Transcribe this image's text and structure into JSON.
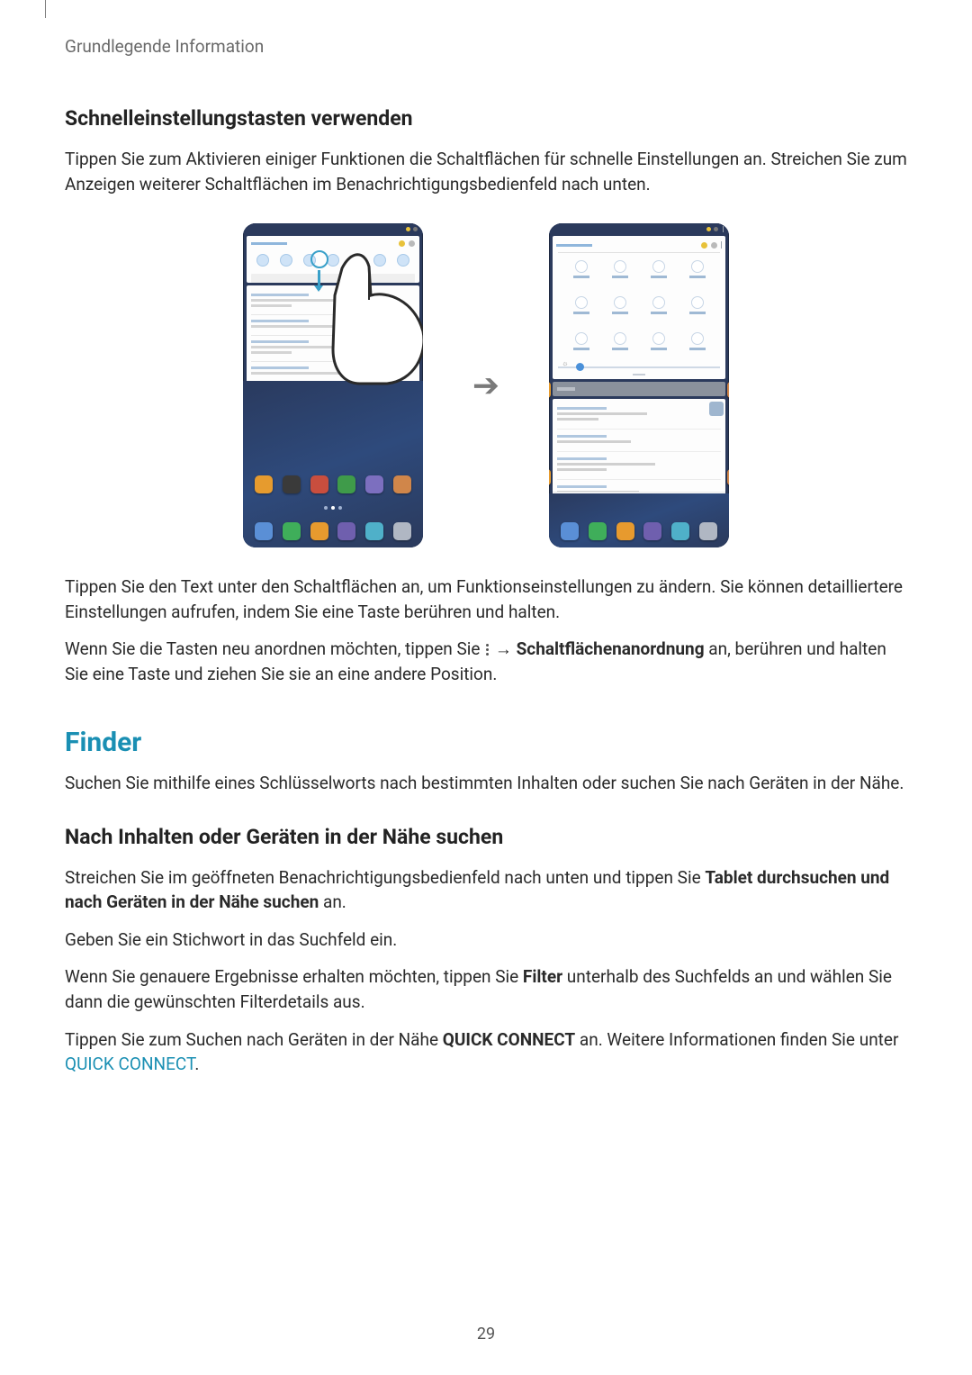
{
  "header": {
    "running": "Grundlegende Information"
  },
  "section1": {
    "heading": "Schnelleinstellungstasten verwenden",
    "p1": "Tippen Sie zum Aktivieren einiger Funktionen die Schaltflächen für schnelle Einstellungen an. Streichen Sie zum Anzeigen weiterer Schaltflächen im Benachrichtigungsbedienfeld nach unten.",
    "p2a": "Tippen Sie den Text unter den Schaltflächen an, um Funktionseinstellungen zu ändern. Sie können detailliertere Einstellungen aufrufen, indem Sie eine Taste berühren und halten.",
    "p3_pre": "Wenn Sie die Tasten neu anordnen möchten, tippen Sie ",
    "p3_arrow": " → ",
    "p3_bold": "Schaltflächenanordnung",
    "p3_post": " an, berühren und halten Sie eine Taste und ziehen Sie sie an eine andere Position."
  },
  "finder": {
    "heading": "Finder",
    "intro": "Suchen Sie mithilfe eines Schlüsselworts nach bestimmten Inhalten oder suchen Sie nach Geräten in der Nähe."
  },
  "section2": {
    "heading": "Nach Inhalten oder Geräten in der Nähe suchen",
    "p1_pre": "Streichen Sie im geöffneten Benachrichtigungsbedienfeld nach unten und tippen Sie ",
    "p1_bold": "Tablet durchsuchen und nach Geräten in der Nähe suchen",
    "p1_post": " an.",
    "p2": "Geben Sie ein Stichwort in das Suchfeld ein.",
    "p3_pre": "Wenn Sie genauere Ergebnisse erhalten möchten, tippen Sie ",
    "p3_bold": "Filter",
    "p3_post": " unterhalb des Suchfelds an und wählen Sie dann die gewünschten Filterdetails aus.",
    "p4_pre": "Tippen Sie zum Suchen nach Geräten in der Nähe ",
    "p4_bold": "QUICK CONNECT",
    "p4_mid": " an. Weitere Informationen finden Sie unter ",
    "p4_link": "QUICK CONNECT",
    "p4_post": "."
  },
  "pageNumber": "29"
}
